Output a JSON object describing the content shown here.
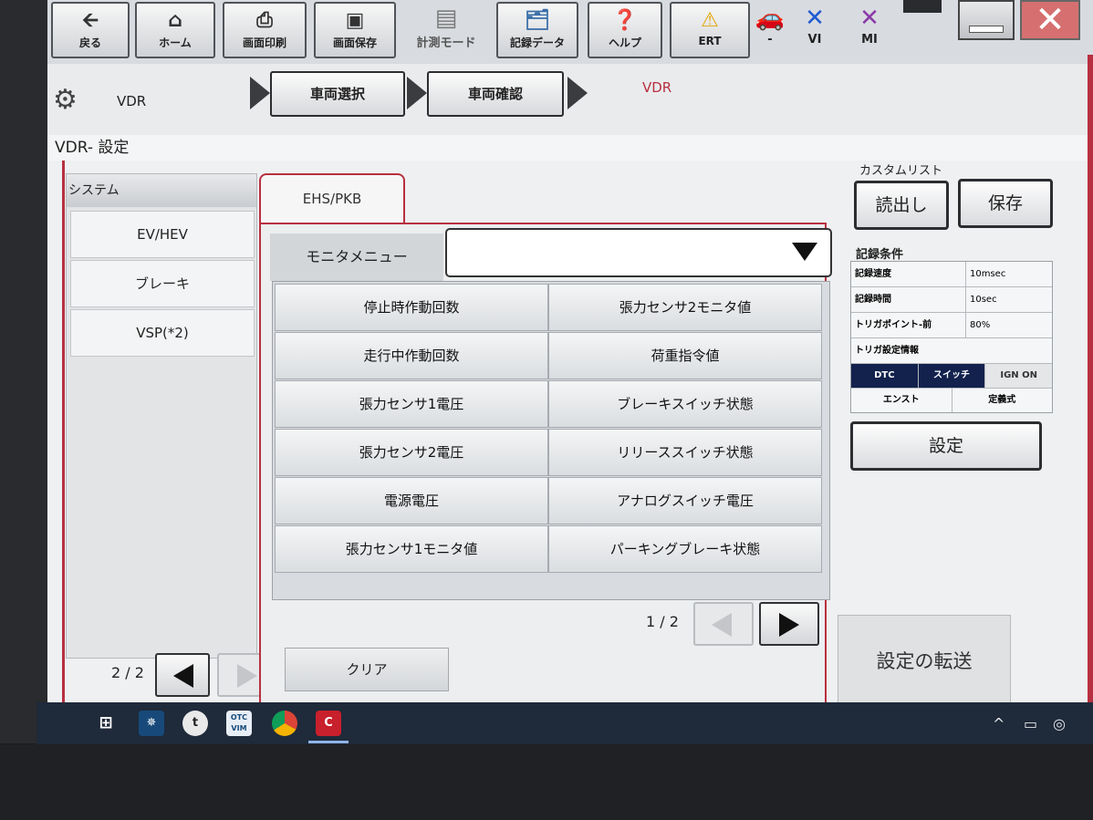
{
  "toolbar": {
    "back": "戻る",
    "home": "ホーム",
    "print": "画面印刷",
    "save_screen": "画面保存",
    "measure_mode": "計測モード",
    "record_data": "記録データ",
    "help": "ヘルプ",
    "ert": "ERT",
    "car": "-",
    "vi": "VI",
    "mi": "MI"
  },
  "breadcrumb": {
    "root": "VDR",
    "step1": "車両選択",
    "step2": "車両確認",
    "current": "VDR"
  },
  "page_title": "VDR- 設定",
  "left_panel": {
    "header": "システム",
    "items": [
      "EV/HEV",
      "ブレーキ",
      "VSP(*2)"
    ],
    "page": "2 / 2"
  },
  "tab": {
    "label": "EHS/PKB"
  },
  "monitor_menu": {
    "label": "モニタメニュー",
    "value": ""
  },
  "grid": {
    "rows": [
      [
        "停止時作動回数",
        "張力センサ2モニタ値"
      ],
      [
        "走行中作動回数",
        "荷重指令値"
      ],
      [
        "張力センサ1電圧",
        "ブレーキスイッチ状態"
      ],
      [
        "張力センサ2電圧",
        "リリーススイッチ状態"
      ],
      [
        "電源電圧",
        "アナログスイッチ電圧"
      ],
      [
        "張力センサ1モニタ値",
        "パーキングブレーキ状態"
      ]
    ],
    "page": "1 / 2"
  },
  "clear_label": "クリア",
  "custom_list": {
    "label": "カスタムリスト",
    "read": "読出し",
    "save": "保存"
  },
  "record_conditions": {
    "label": "記録条件",
    "rows": [
      {
        "key": "記録速度",
        "value": "10msec"
      },
      {
        "key": "記録時間",
        "value": "10sec"
      },
      {
        "key": "トリガポイント-前",
        "value": "80%"
      }
    ],
    "trigger_label": "トリガ設定情報",
    "trigger_row1": [
      "DTC",
      "スイッチ",
      "IGN ON"
    ],
    "trigger_row2": [
      "エンスト",
      "定義式"
    ],
    "set": "設定"
  },
  "transfer_label": "設定の転送",
  "taskbar": {
    "otc_label": "OTC VIM",
    "tray_caret": "^"
  },
  "colors": {
    "accent_red": "#b83040",
    "active_trigger": "#12224d",
    "taskbar": "#1f2a3a"
  }
}
